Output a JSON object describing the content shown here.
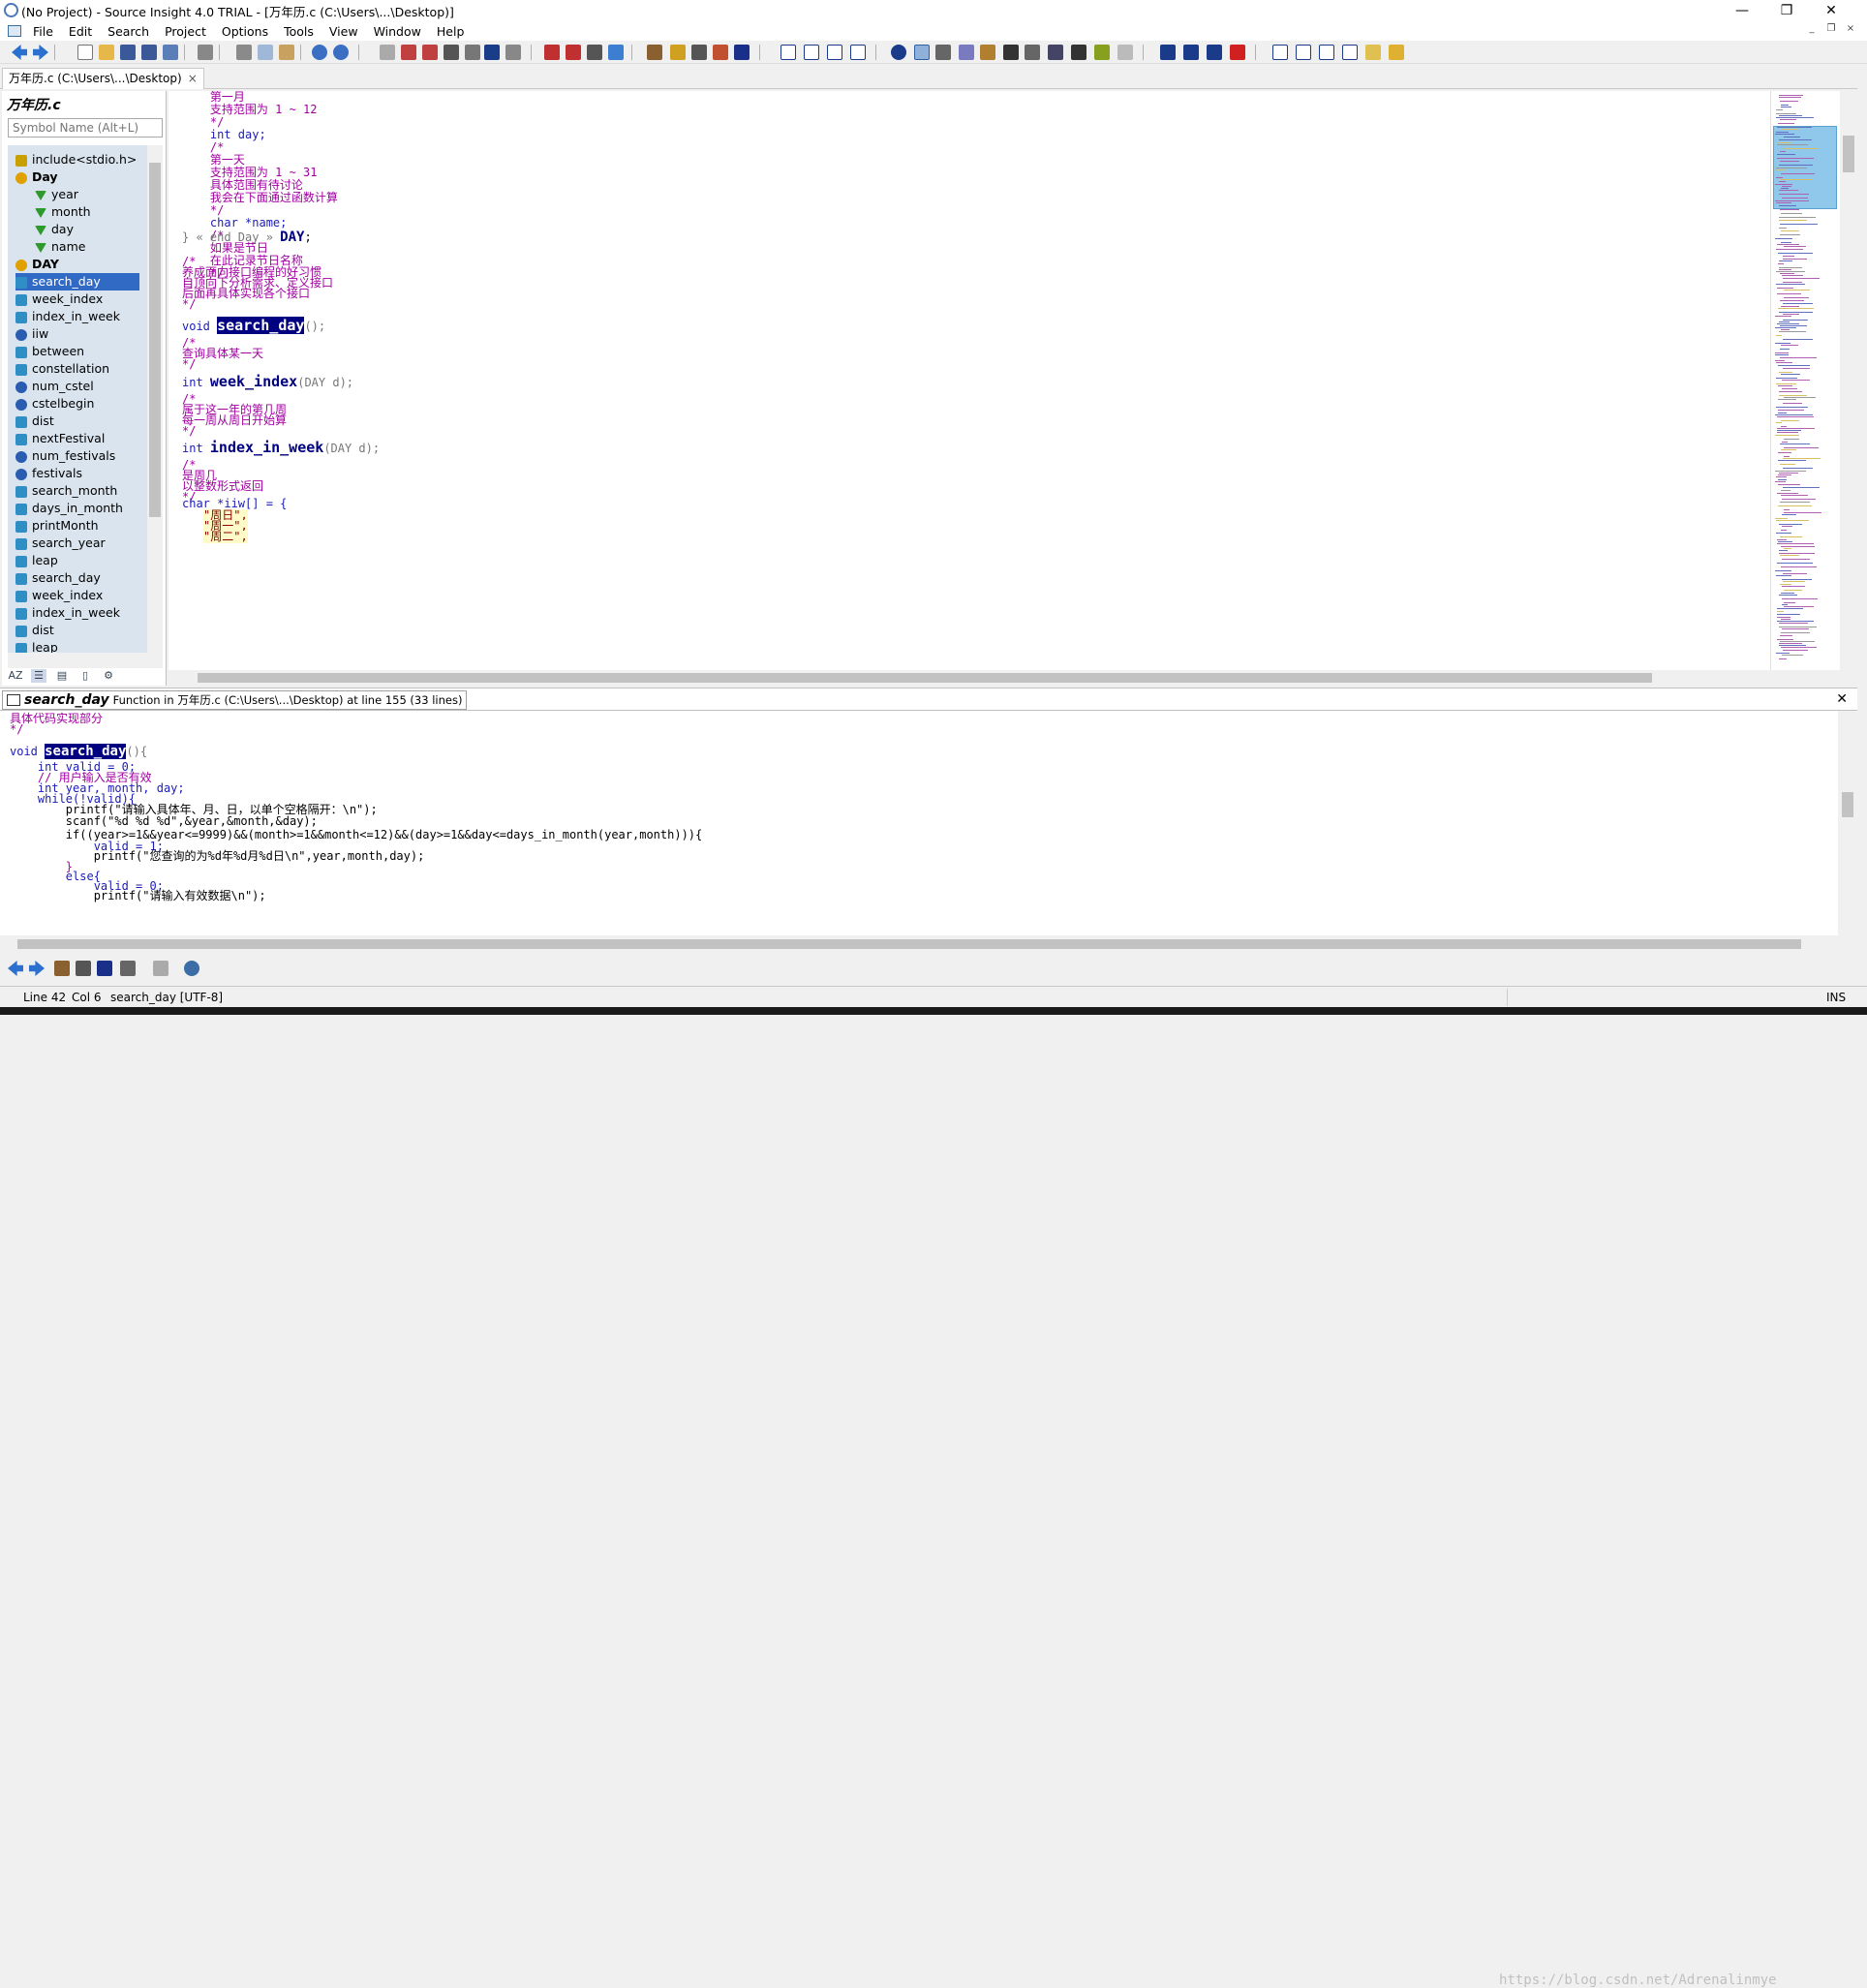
{
  "window": {
    "title": "(No Project) - Source Insight 4.0 TRIAL - [万年历.c (C:\\Users\\...\\Desktop)]",
    "min": "—",
    "max": "❐",
    "close": "✕"
  },
  "menu": [
    "File",
    "Edit",
    "Search",
    "Project",
    "Options",
    "Tools",
    "View",
    "Window",
    "Help"
  ],
  "tab": {
    "label": "万年历.c (C:\\Users\\...\\Desktop)",
    "close": "×"
  },
  "symbol_panel": {
    "title": "万年历.c",
    "search_placeholder": "Symbol Name (Alt+L)",
    "items": [
      {
        "label": "include<stdio.h>",
        "kind": "inc"
      },
      {
        "label": "Day",
        "kind": "struct"
      },
      {
        "label": "year",
        "kind": "field"
      },
      {
        "label": "month",
        "kind": "field"
      },
      {
        "label": "day",
        "kind": "field"
      },
      {
        "label": "name",
        "kind": "field"
      },
      {
        "label": "DAY",
        "kind": "typedef"
      },
      {
        "label": "search_day",
        "kind": "fn",
        "selected": true
      },
      {
        "label": "week_index",
        "kind": "fn"
      },
      {
        "label": "index_in_week",
        "kind": "fn"
      },
      {
        "label": "iiw",
        "kind": "var"
      },
      {
        "label": "between",
        "kind": "fn"
      },
      {
        "label": "constellation",
        "kind": "fn"
      },
      {
        "label": "num_cstel",
        "kind": "var"
      },
      {
        "label": "cstelbegin",
        "kind": "var"
      },
      {
        "label": "dist",
        "kind": "fn"
      },
      {
        "label": "nextFestival",
        "kind": "fn"
      },
      {
        "label": "num_festivals",
        "kind": "var"
      },
      {
        "label": "festivals",
        "kind": "var"
      },
      {
        "label": "search_month",
        "kind": "fn"
      },
      {
        "label": "days_in_month",
        "kind": "fn"
      },
      {
        "label": "printMonth",
        "kind": "fn"
      },
      {
        "label": "search_year",
        "kind": "fn"
      },
      {
        "label": "leap",
        "kind": "fn"
      },
      {
        "label": "search_day",
        "kind": "fn"
      },
      {
        "label": "week_index",
        "kind": "fn"
      },
      {
        "label": "index_in_week",
        "kind": "fn"
      },
      {
        "label": "dist",
        "kind": "fn"
      },
      {
        "label": "leap",
        "kind": "fn"
      }
    ]
  },
  "editor": {
    "lines": [
      {
        "t": "    第一月",
        "c": "cm"
      },
      {
        "t": "    支持范围为 1 ~ 12",
        "c": "cm"
      },
      {
        "t": "    */",
        "c": "cm"
      },
      {
        "t": "    int day;",
        "c": "kw"
      },
      {
        "t": "    /*",
        "c": "cm"
      },
      {
        "t": "    第一天",
        "c": "cm"
      },
      {
        "t": "    支持范围为 1 ~ 31",
        "c": "cm"
      },
      {
        "t": "    具体范围有待讨论",
        "c": "cm"
      },
      {
        "t": "    我会在下面通过函数计算",
        "c": "cm"
      },
      {
        "t": "    */",
        "c": "cm"
      },
      {
        "t": "    char *name;",
        "c": "kw"
      },
      {
        "t": "    /*",
        "c": "cm"
      },
      {
        "t": "    如果是节日",
        "c": "cm"
      },
      {
        "t": "    在此记录节日名称",
        "c": "cm"
      },
      {
        "t": "    */",
        "c": "cm"
      }
    ],
    "end_day": "} « end Day » ",
    "end_day_name": "DAY",
    "end_day_semi": ";",
    "block2": [
      "/*",
      "养成面向接口编程的好习惯",
      "自顶向下分析需求、定义接口",
      "后面再具体实现各个接口",
      "*/"
    ],
    "decl_search_day": {
      "ret": "void ",
      "name": "search_day",
      "tail": "();"
    },
    "cm_search_day": [
      "/*",
      "查询具体某一天",
      "*/"
    ],
    "decl_week_index": {
      "ret": "int ",
      "name": "week_index",
      "tail": "(DAY d);"
    },
    "cm_week_index": [
      "/*",
      "属于这一年的第几周",
      "每一周从周日开始算",
      "*/"
    ],
    "decl_index_in_week": {
      "ret": "int ",
      "name": "index_in_week",
      "tail": "(DAY d);"
    },
    "cm_index_in_week": [
      "/*",
      "是周几",
      "以整数形式返回",
      "*/"
    ],
    "iiw_decl": "char *iiw[] = {",
    "iiw_items": [
      "\"周日\",",
      "\"周一\",",
      "\"周二\","
    ]
  },
  "context": {
    "name": "search_day",
    "info": "Function in 万年历.c (C:\\Users\\...\\Desktop) at line 155 (33 lines)",
    "lines": [
      {
        "t": "具体代码实现部分",
        "c": "cm"
      },
      {
        "t": "*/",
        "c": "cm"
      },
      {
        "t": "",
        "c": ""
      },
      {
        "t": "",
        "c": ""
      },
      {
        "t": "    int valid = 0;",
        "c": "kw"
      },
      {
        "t": "    // 用户输入是否有效",
        "c": "cm"
      },
      {
        "t": "    int year, month, day;",
        "c": "kw"
      },
      {
        "t": "    while(!valid){",
        "c": "kw"
      },
      {
        "t": "        printf(\"请输入具体年、月、日，以单个空格隔开：\\n\");",
        "c": "plain"
      },
      {
        "t": "        scanf(\"%d %d %d\",&year,&month,&day);",
        "c": "plain"
      },
      {
        "t": "        if((year>=1&&year<=9999)&&(month>=1&&month<=12)&&(day>=1&&day<=days_in_month(year,month))){",
        "c": "plain"
      },
      {
        "t": "            valid = 1;",
        "c": "kw"
      },
      {
        "t": "            printf(\"您查询的为%d年%d月%d日\\n\",year,month,day);",
        "c": "plain"
      },
      {
        "t": "        }",
        "c": "cm"
      },
      {
        "t": "        else{",
        "c": "kw"
      },
      {
        "t": "            valid = 0;",
        "c": "kw"
      },
      {
        "t": "            printf(\"请输入有效数据\\n\");",
        "c": "plain"
      }
    ],
    "decl": {
      "ret": "void ",
      "name": "search_day",
      "tail": "(){"
    },
    "close": "✕"
  },
  "status": {
    "line": "Line 42",
    "col": "Col 6",
    "symbol": "search_day [UTF-8]",
    "mode": "INS",
    "watermark": "https://blog.csdn.net/Adrenalinmye"
  }
}
